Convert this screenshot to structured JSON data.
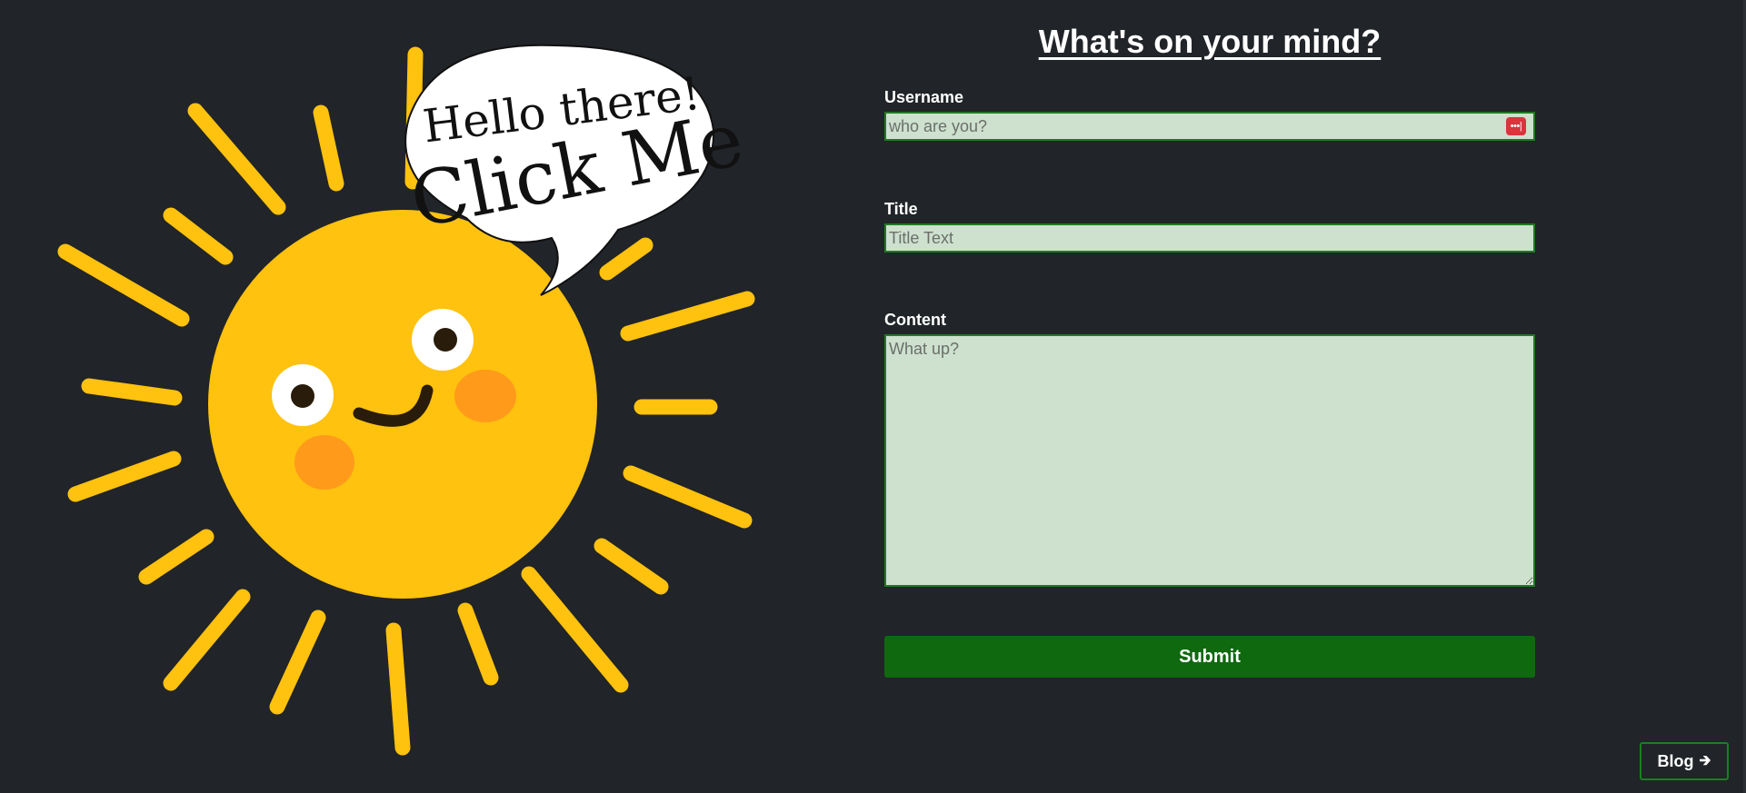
{
  "hero": {
    "bubble_line1": "Hello there!",
    "bubble_line2": "Click Me"
  },
  "form": {
    "title": "What's on your mind?",
    "username": {
      "label": "Username",
      "placeholder": "who are you?",
      "value": ""
    },
    "post_title": {
      "label": "Title",
      "placeholder": "Title Text",
      "value": ""
    },
    "content": {
      "label": "Content",
      "placeholder": "What up?",
      "value": ""
    },
    "submit_label": "Submit"
  },
  "nav": {
    "blog_label": "Blog",
    "blog_icon": "arrow-right-icon"
  },
  "icons": {
    "password_manager": "password-manager-icon"
  },
  "colors": {
    "background": "#212428",
    "sun": "#FFC20E",
    "cheek": "#FF9A1A",
    "input_fill": "#CDE1CE",
    "input_border": "#1F7A23",
    "submit": "#0F690F"
  }
}
